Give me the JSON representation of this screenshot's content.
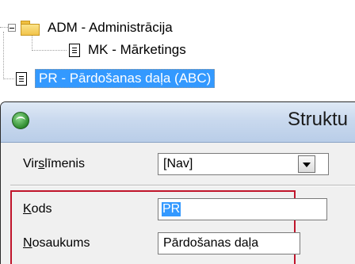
{
  "tree": {
    "items": [
      {
        "label": "ADM - Administrācija",
        "icon": "folder-icon",
        "expanded": true
      },
      {
        "label": "MK - Mārketings",
        "icon": "document-icon"
      },
      {
        "label": "PR - Pārdošanas daļa (ABC)",
        "icon": "document-icon",
        "selected": true
      }
    ]
  },
  "dialog": {
    "title": "Struktu",
    "fields": {
      "virslimenis": {
        "label_pre": "Vir",
        "label_accel": "s",
        "label_post": "līmenis",
        "value": "[Nav]"
      },
      "kods": {
        "label_pre": "",
        "label_accel": "K",
        "label_post": "ods",
        "value": "PR"
      },
      "nosaukums": {
        "label_pre": "",
        "label_accel": "N",
        "label_post": "osaukums",
        "value": "Pārdošanas daļa"
      }
    }
  },
  "colors": {
    "selection": "#3399ff",
    "highlight_border": "#c0152b",
    "titlebar": "#c9d9ee"
  }
}
